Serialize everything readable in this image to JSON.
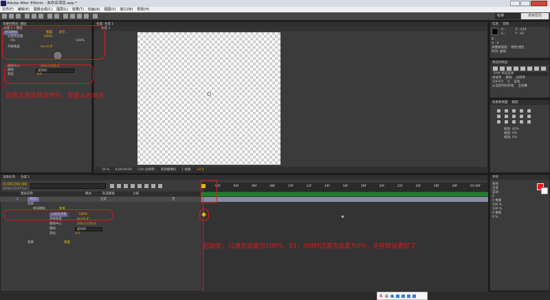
{
  "window": {
    "title": "Adobe After Effects - 未命名项目.aep *"
  },
  "menu": [
    "文件(F)",
    "编辑(E)",
    "图像合成(C)",
    "图层(L)",
    "效果(T)",
    "动画(A)",
    "视图(V)",
    "窗口(W)",
    "帮助(H)"
  ],
  "workspace": {
    "label": "标准",
    "search_label": "搜索帮助"
  },
  "effects_panel": {
    "tab": "效果控制台: 图层",
    "path": "合成 1 • 图层",
    "effect_name": "径向擦除",
    "reset_label": "重置",
    "about_label": "关于...",
    "prop1_label": "过渡完成量",
    "prop1_value": "100%",
    "pct_left": "0%",
    "pct_right": "100%",
    "prop2_label": "开始角度",
    "prop2_value": "0x+0.0°",
    "prop3_label": "擦除中心",
    "prop3_value": "200.0,100.0",
    "prop4_label": "擦除",
    "prop4_value": "逆时针",
    "prop5_label": "羽化",
    "prop5_value": "0.0"
  },
  "composition_panel": {
    "tab": "合成: 合成 1",
    "subtab": "合成 1",
    "zoom": "50 %",
    "timecode": "0;00;00;00",
    "resolution": "(1/4 分辨率)",
    "camera": "有效摄像机",
    "views": "1 视图",
    "offset": "+0.0"
  },
  "info_panel": {
    "tabs": [
      "信息",
      "音频"
    ],
    "r": "R :",
    "g": "G :",
    "b": "B :",
    "a": "A : 0",
    "x": "X : 456",
    "y": "Y : 92",
    "caption1": "关键帧插值:",
    "caption1_value": "线性/线性",
    "caption2": "时间: 曲线"
  },
  "preview_panel": {
    "tab": "预览控制台",
    "ram_label": "RAM 预览选项",
    "frame_rate_label": "帧速率",
    "skip_label": "跳帧",
    "resolution_label": "分辨率",
    "frame_rate_value": "(29.97)",
    "skip_value": "0",
    "res_value": "自动",
    "from_label": "从当前时间开始",
    "full_label": "全屏幕"
  },
  "paragraph_panel": {
    "tabs": [
      "效果和预置",
      "跟踪"
    ],
    "items": [
      "缩放: 42%",
      "缩放: 0%",
      "缩放: 0%"
    ]
  },
  "char_panel": {
    "tab": "字符",
    "items": [
      "宋体",
      "正常",
      "自动",
      "0",
      "0 像素",
      "100 %",
      "100 %",
      "0 像素",
      "0 %"
    ]
  },
  "timeline": {
    "tab": "合成 1",
    "render_tab": "渲染队列",
    "timecode": "0;00;00;00",
    "frames": "00000 (29.97 fps)",
    "search_placeholder": "",
    "col_layer": "图层名称",
    "col_mode": "模式",
    "col_trkmat": "轨道蒙板",
    "col_parent": "父级",
    "layer_number": "1",
    "layer_name": "[图层]",
    "mode_value": "正常",
    "parent_value": "无",
    "effects_label": "效果",
    "fx_name": "径向擦除",
    "fx_reset": "重置",
    "transform_label": "变换",
    "transform_reset": "重置",
    "rows": [
      {
        "label": "过渡完成量",
        "value": "100%"
      },
      {
        "label": "开始角度",
        "value": "0x+0.0°"
      },
      {
        "label": "擦除中心",
        "value": "200.0,150.0"
      },
      {
        "label": "擦除",
        "value": "逆时针"
      },
      {
        "label": "羽化",
        "value": "0.0"
      }
    ],
    "ticks": [
      "02f",
      "04f",
      "06f",
      "08f",
      "10f",
      "12f",
      "14f",
      "16f",
      "18f",
      "20f",
      "22f",
      "24f",
      "26f",
      "28f",
      "01:00f"
    ]
  },
  "annotations": {
    "note1": "划变这里选择逆时针，就是从右向左",
    "note2": "起始处，过渡完成量为100%，01：00f时过渡完成量为0%，这样就设置好了"
  },
  "ime": {
    "label": "中"
  },
  "colors": {
    "accent_red": "#e0191e",
    "value_yellow": "#e8b400",
    "bg": "#3b3b3b"
  }
}
